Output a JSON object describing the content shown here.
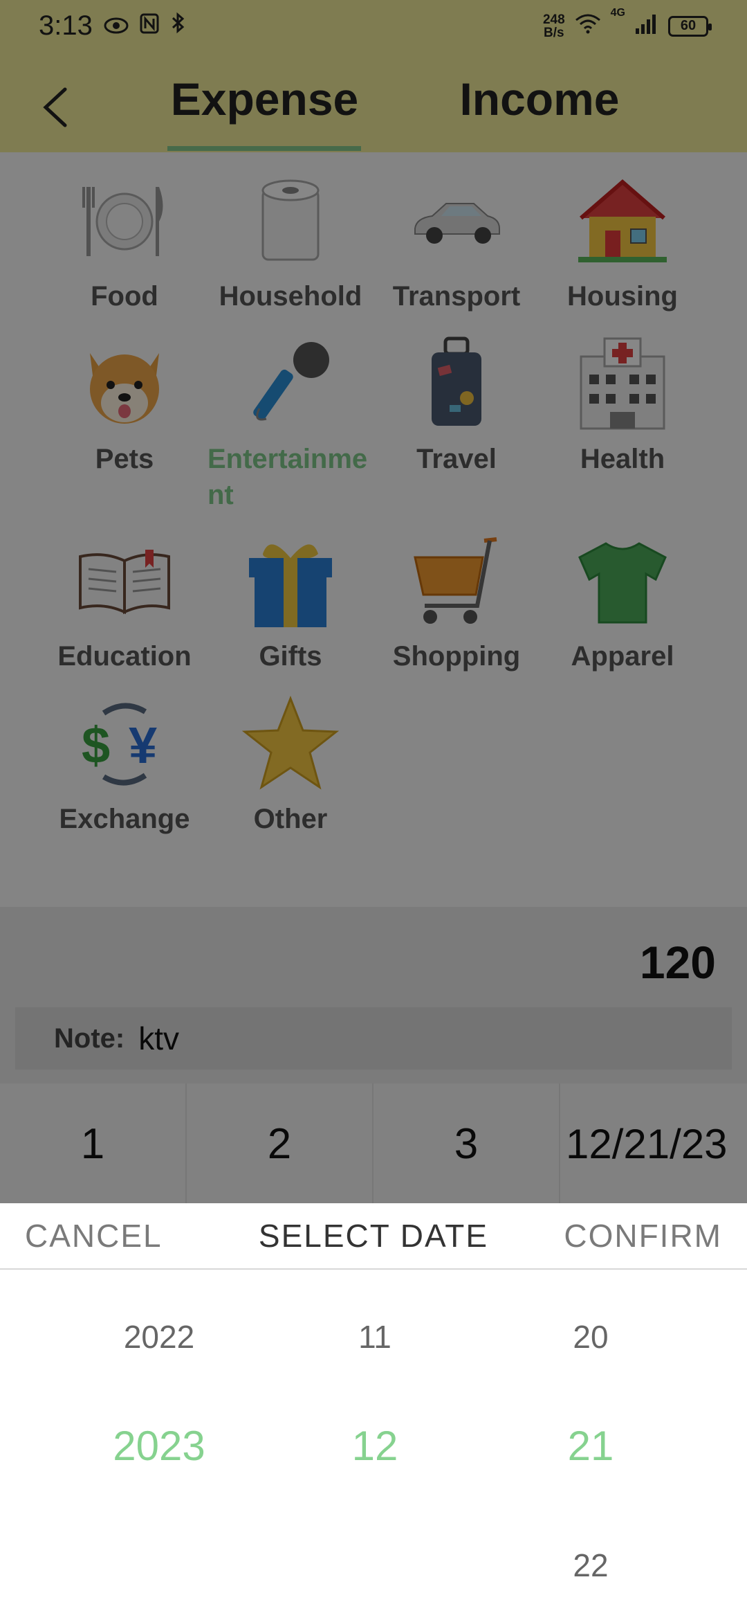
{
  "status_bar": {
    "time": "3:13",
    "net_speed_value": "248",
    "net_speed_unit": "B/s",
    "network_type": "4G",
    "battery": "60"
  },
  "header": {
    "tabs": [
      {
        "label": "Expense",
        "active": true
      },
      {
        "label": "Income",
        "active": false
      }
    ]
  },
  "categories": [
    {
      "label": "Food",
      "icon": "fork-plate-knife-icon"
    },
    {
      "label": "Household",
      "icon": "toilet-paper-icon"
    },
    {
      "label": "Transport",
      "icon": "car-icon"
    },
    {
      "label": "Housing",
      "icon": "house-icon"
    },
    {
      "label": "Pets",
      "icon": "dog-icon"
    },
    {
      "label": "Entertainment",
      "icon": "microphone-icon",
      "selected": true
    },
    {
      "label": "Travel",
      "icon": "luggage-icon"
    },
    {
      "label": "Health",
      "icon": "hospital-icon"
    },
    {
      "label": "Education",
      "icon": "open-book-icon"
    },
    {
      "label": "Gifts",
      "icon": "gift-icon"
    },
    {
      "label": "Shopping",
      "icon": "shopping-cart-icon"
    },
    {
      "label": "Apparel",
      "icon": "tshirt-icon"
    },
    {
      "label": "Exchange",
      "icon": "currency-exchange-icon"
    },
    {
      "label": "Other",
      "icon": "star-icon"
    }
  ],
  "amount": "120",
  "note": {
    "label": "Note:",
    "value": "ktv"
  },
  "keypad": {
    "keys": [
      "1",
      "2",
      "3"
    ],
    "date": "12/21/23"
  },
  "date_picker": {
    "cancel": "CANCEL",
    "title": "SELECT DATE",
    "confirm": "CONFIRM",
    "year": {
      "prev": "2022",
      "current": "2023",
      "next": ""
    },
    "month": {
      "prev": "11",
      "current": "12",
      "next": ""
    },
    "day": {
      "prev": "20",
      "current": "21",
      "next": "22"
    }
  },
  "colors": {
    "header_bg": "#f0ea9a",
    "accent_green": "#86d28f",
    "overlay": "rgba(0,0,0,0.47)"
  }
}
